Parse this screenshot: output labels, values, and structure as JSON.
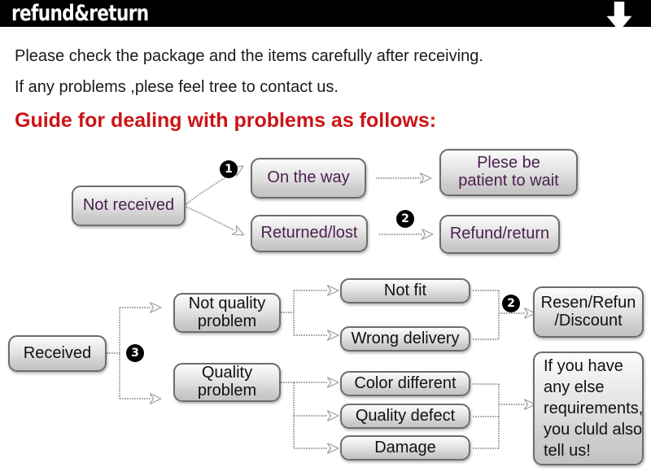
{
  "header": {
    "title": "refund&return",
    "arrow_icon": "down-arrow-icon"
  },
  "intro": {
    "line1": "Please check the package and the items carefully after receiving.",
    "line2": "If any problems ,plese feel tree to contact us.",
    "guide_heading": "Guide for dealing with problems as follows:",
    "heading_color": "#cc1417"
  },
  "flow": {
    "section_not_received": {
      "source": "Not received",
      "branches": [
        {
          "badge": "1",
          "state": "On the way",
          "action": "Plese be\npatient to wait"
        },
        {
          "badge": "2",
          "state": "Returned/lost",
          "action": "Refund/return"
        }
      ]
    },
    "section_received": {
      "source": "Received",
      "badge": "3",
      "branches": [
        {
          "category": "Not quality\nproblem",
          "issues": [
            "Not fit",
            "Wrong delivery"
          ],
          "badge": "2",
          "resolution": "Resen/Refun\n/Discount"
        },
        {
          "category": "Quality\nproblem",
          "issues": [
            "Color different",
            "Quality defect",
            "Damage"
          ],
          "resolution": "If you have\nany else\nrequirements,\nyou cluld also\ntell us!"
        }
      ]
    }
  },
  "boxes": {
    "not_received": "Not received",
    "on_the_way": "On the way",
    "returned_lost": "Returned/lost",
    "please_wait": "Plese be\npatient to wait",
    "refund_return": "Refund/return",
    "received": "Received",
    "not_quality_problem": "Not quality\nproblem",
    "quality_problem": "Quality\nproblem",
    "not_fit": "Not fit",
    "wrong_delivery": "Wrong delivery",
    "color_different": "Color different",
    "quality_defect": "Quality defect",
    "damage": "Damage",
    "resend_refund_discount": "Resen/Refun\n/Discount",
    "tell_us": "If you have\nany else\nrequirements,\nyou cluld also\ntell us!"
  },
  "badges": {
    "one": "1",
    "two_top": "2",
    "three": "3",
    "two_right": "2"
  },
  "colors": {
    "header_bg": "#000000",
    "header_text": "#ffffff",
    "heading_red": "#cc1417",
    "box_text_purple": "#4a1f4e",
    "box_text_black": "#111111",
    "box_border": "#6d6d6d",
    "connector": "#8a8a8a"
  }
}
